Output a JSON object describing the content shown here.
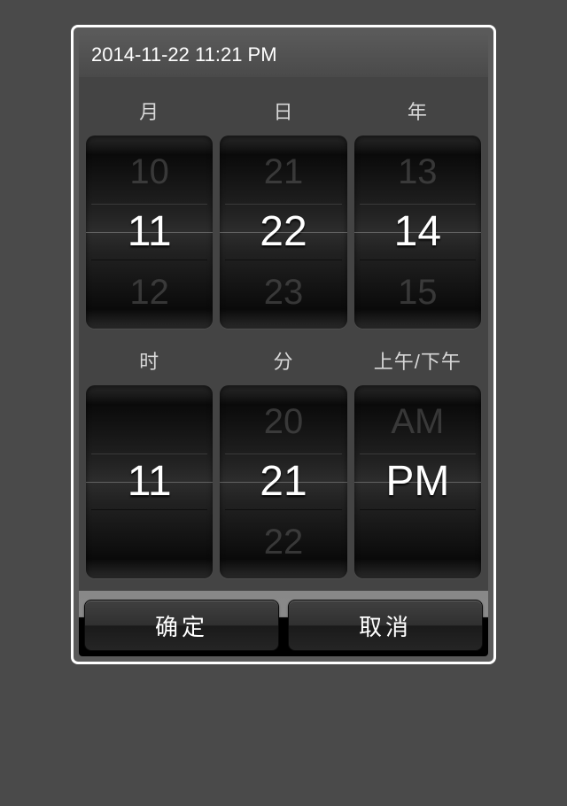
{
  "header": {
    "datetime": "2014-11-22 11:21 PM"
  },
  "labels": {
    "month": "月",
    "day": "日",
    "year": "年",
    "hour": "时",
    "minute": "分",
    "ampm": "上午/下午"
  },
  "wheels": {
    "month": {
      "prev": "10",
      "current": "11",
      "next": "12"
    },
    "day": {
      "prev": "21",
      "current": "22",
      "next": "23"
    },
    "year": {
      "prev": "13",
      "current": "14",
      "next": "15"
    },
    "hour": {
      "prev": "",
      "current": "11",
      "next": ""
    },
    "minute": {
      "prev": "20",
      "current": "21",
      "next": "22"
    },
    "ampm": {
      "prev": "AM",
      "current": "PM",
      "next": ""
    }
  },
  "buttons": {
    "confirm": "确定",
    "cancel": "取消"
  }
}
